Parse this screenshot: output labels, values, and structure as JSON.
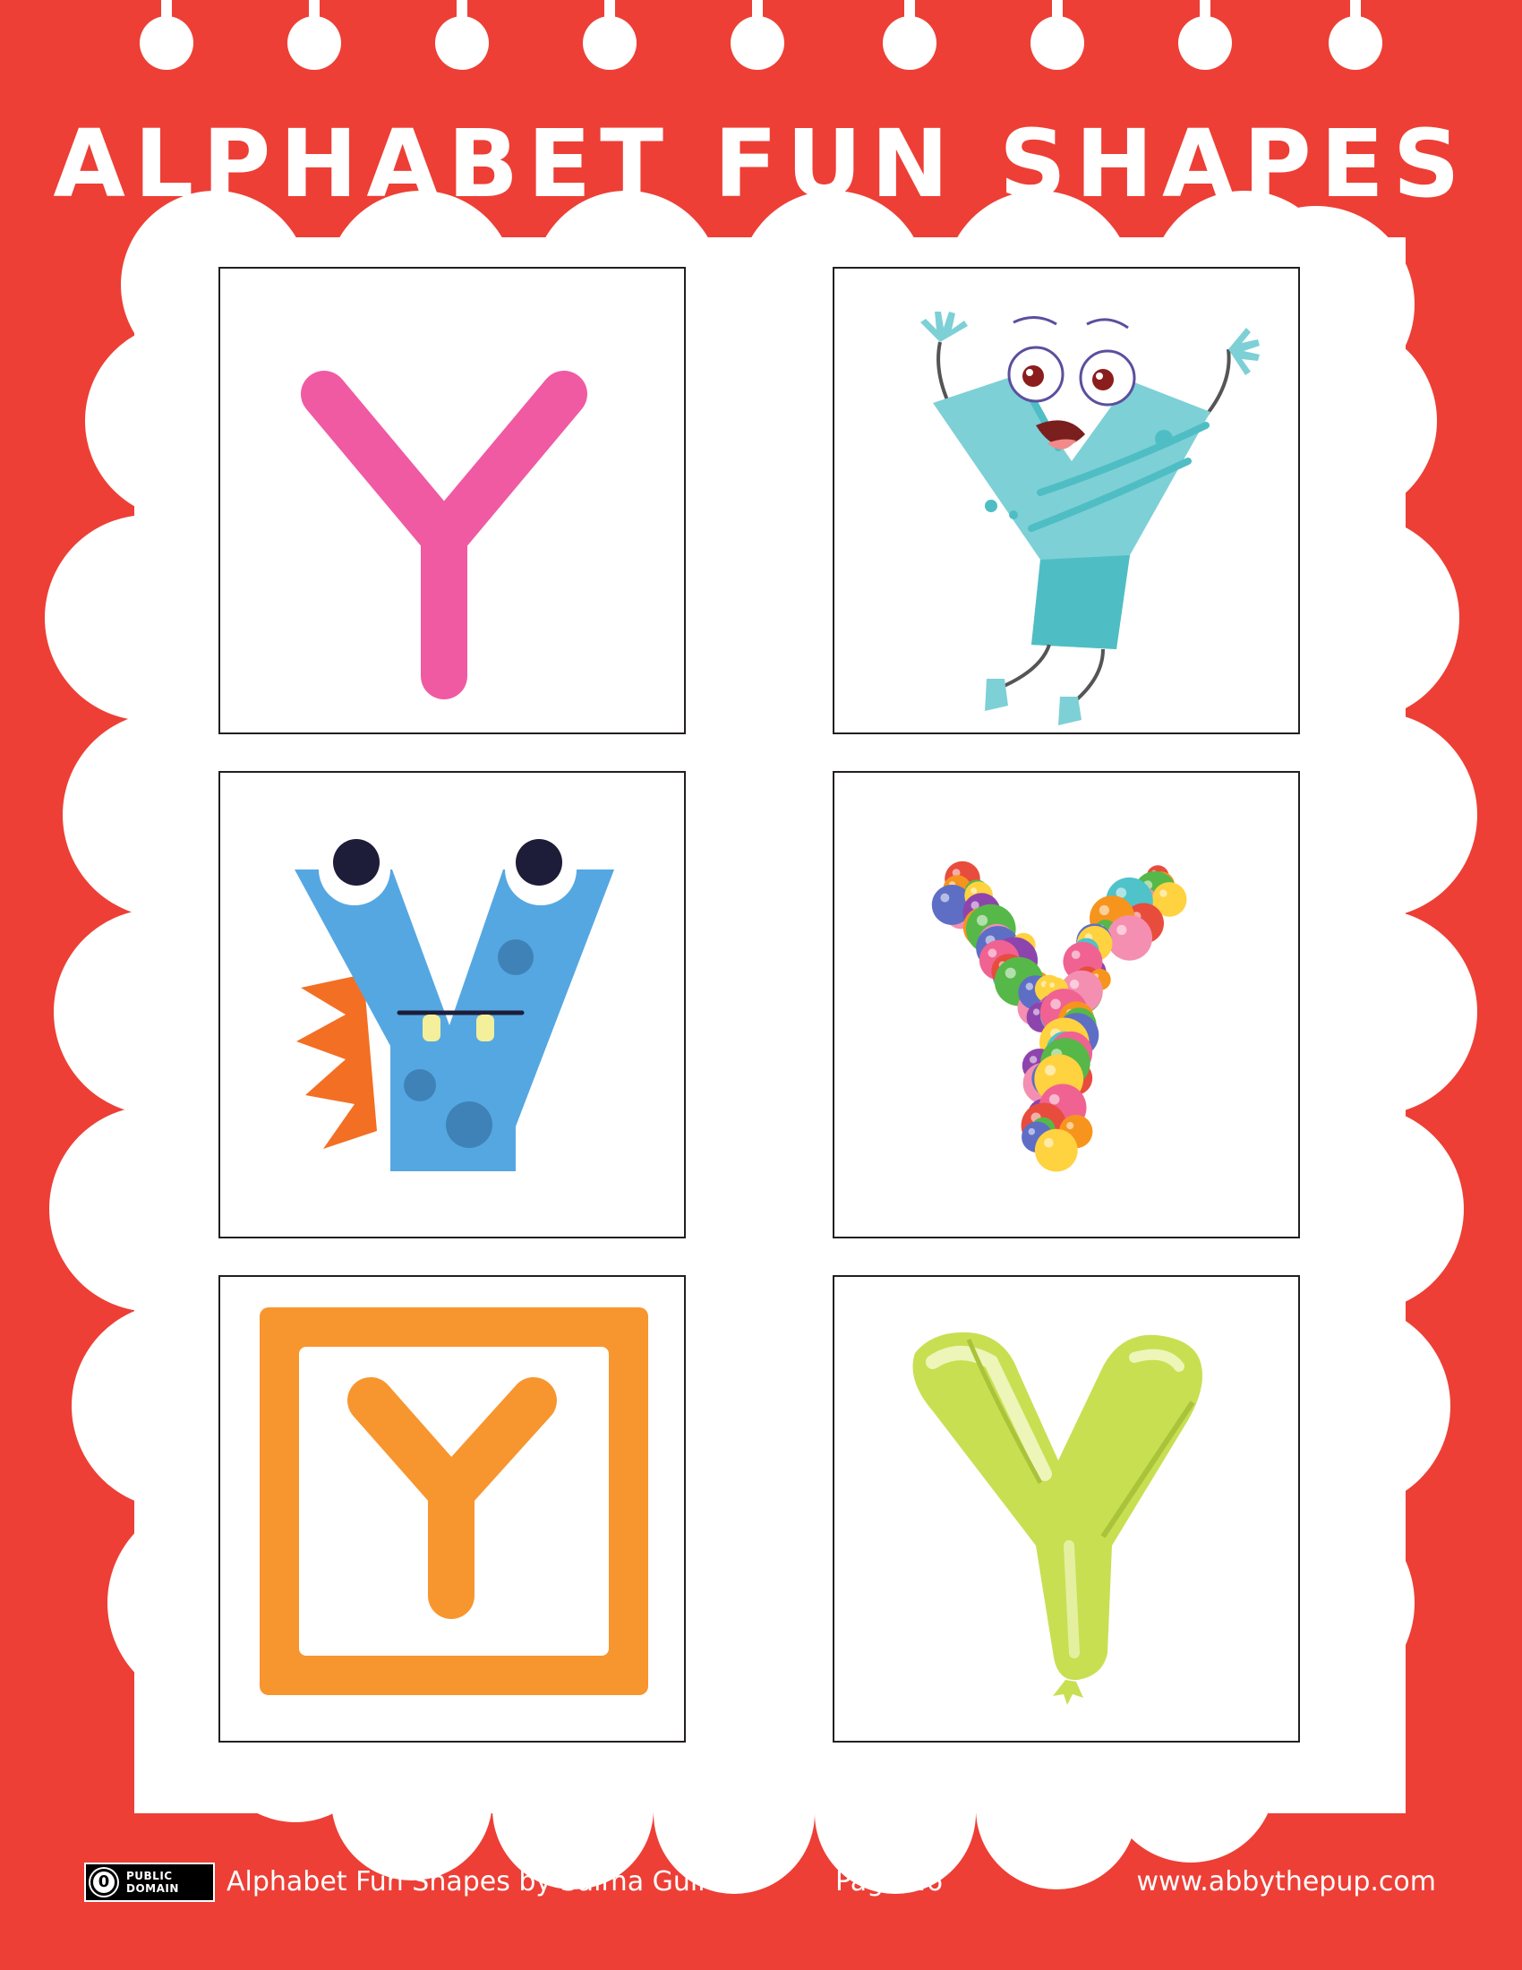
{
  "title": "ALPHABET FUN SHAPES",
  "cards": [
    {
      "letter": "Y",
      "style": "plain-pink-letter",
      "color": "#f05aa2"
    },
    {
      "letter": "Y",
      "style": "cartoon-character-letter",
      "color": "#7dd0d6"
    },
    {
      "letter": "Y",
      "style": "monster-letter",
      "color": "#55a7e2"
    },
    {
      "letter": "Y",
      "style": "balloon-cluster-letter",
      "color": "#f7941d"
    },
    {
      "letter": "Y",
      "style": "letter-block",
      "color": "#f7962f"
    },
    {
      "letter": "Y",
      "style": "inflatable-balloon-letter",
      "color": "#c8df52"
    }
  ],
  "footer": {
    "badge_line1": "PUBLIC",
    "badge_line2": "DOMAIN",
    "badge_symbol": "0",
    "credit": "Alphabet Fun Shapes by Salma Gull",
    "page": "Page 26",
    "website": "www.abbythepup.com"
  },
  "colors": {
    "background": "#ed3f36",
    "panel": "#ffffff",
    "card_border": "#231f20"
  }
}
